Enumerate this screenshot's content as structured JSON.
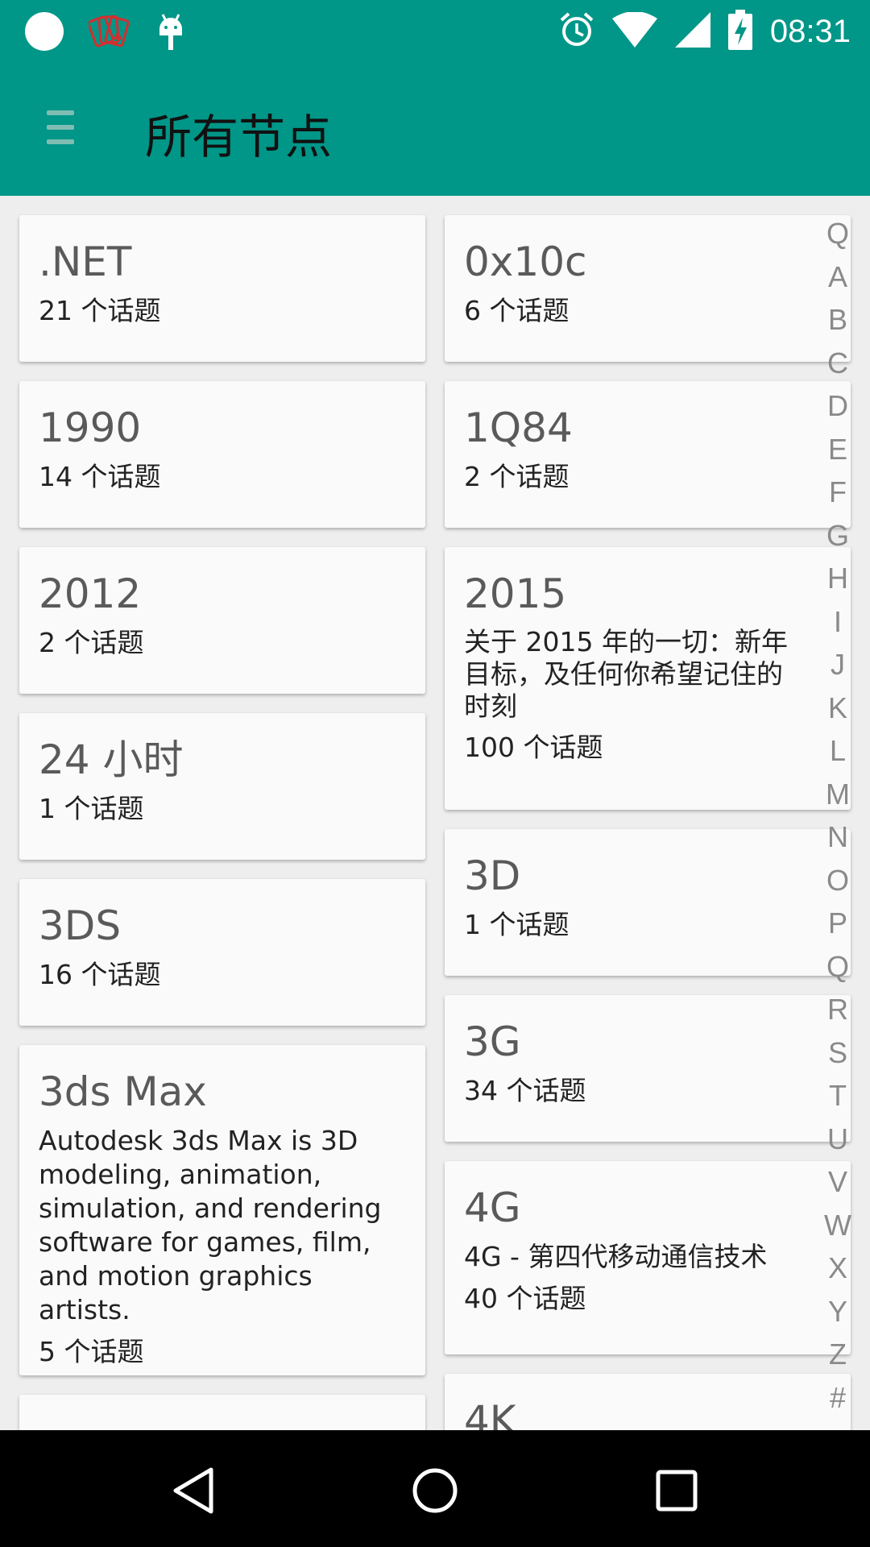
{
  "status_bar": {
    "time": "08:31",
    "icons": [
      "circle-notification-icon",
      "cards-app-icon",
      "android-debug-icon",
      "alarm-icon",
      "wifi-icon",
      "signal-icon",
      "battery-charging-icon"
    ]
  },
  "app_bar": {
    "menu_icon": "menu-icon",
    "title": "所有节点"
  },
  "nodes": [
    {
      "name": ".NET",
      "desc": "",
      "count": "21 个话题"
    },
    {
      "name": "0x10c",
      "desc": "",
      "count": "6 个话题"
    },
    {
      "name": "1990",
      "desc": "",
      "count": "14 个话题"
    },
    {
      "name": "1Q84",
      "desc": "",
      "count": "2 个话题"
    },
    {
      "name": "2012",
      "desc": "",
      "count": "2 个话题"
    },
    {
      "name": "2015",
      "desc": "关于 2015 年的一切：新年目标，及任何你希望记住的时刻",
      "count": "100 个话题"
    },
    {
      "name": "24 小时",
      "desc": "",
      "count": "1 个话题"
    },
    {
      "name": "3D",
      "desc": "",
      "count": "1 个话题"
    },
    {
      "name": "3DS",
      "desc": "",
      "count": "16 个话题"
    },
    {
      "name": "3G",
      "desc": "",
      "count": "34 个话题"
    },
    {
      "name": "3ds Max",
      "desc": "Autodesk 3ds Max is 3D modeling, animation, simulation, and rendering software for games, film, and motion graphics artists.",
      "count": "5 个话题"
    },
    {
      "name": "4G",
      "desc": "4G - 第四代移动通信技术",
      "count": "40 个话题"
    },
    {
      "name": "4K",
      "desc": "",
      "count": ""
    }
  ],
  "alphabet_index": [
    "Q",
    "A",
    "B",
    "C",
    "D",
    "E",
    "F",
    "G",
    "H",
    "I",
    "J",
    "K",
    "L",
    "M",
    "N",
    "O",
    "P",
    "Q",
    "R",
    "S",
    "T",
    "U",
    "V",
    "W",
    "X",
    "Y",
    "Z",
    "#"
  ],
  "nav_bar": {
    "back_icon": "back-triangle-icon",
    "home_icon": "home-circle-icon",
    "recents_icon": "recents-square-icon"
  },
  "colors": {
    "primary": "#009688",
    "card": "#fafafa",
    "background": "#eeeeee"
  }
}
